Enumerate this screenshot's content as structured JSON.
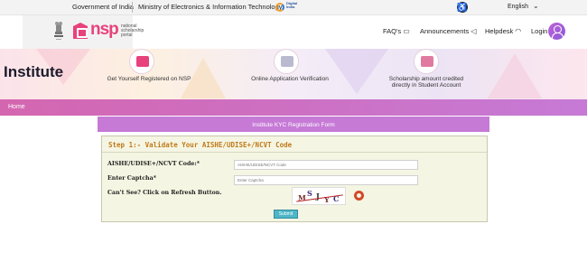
{
  "gov_bar": {
    "government": "Government of India",
    "ministry": "Ministry of Electronics & Information Technology",
    "digital_india": "Digital India",
    "language": "English"
  },
  "header": {
    "logo_text": "nsp",
    "logo_sub": "national scholarship portal",
    "nav": {
      "faqs": "FAQ's",
      "announcements": "Announcements",
      "helpdesk": "Helpdesk",
      "login": "Login"
    }
  },
  "banner": {
    "title": "Institute",
    "steps": [
      {
        "label": "Get Yourself Registered on NSP",
        "icon": "register-icon"
      },
      {
        "label": "Online Application Verification",
        "icon": "verification-icon"
      },
      {
        "label": "Scholarship amount credited directly in Student Account",
        "icon": "scholarship-icon"
      }
    ]
  },
  "breadcrumb": {
    "home": "Home"
  },
  "form": {
    "title": "Institute KYC Registration Form",
    "step_heading": "Step 1:- Validate Your AISHE/UDISE+/NCVT Code",
    "code_label": "AISHE/UDISE+/NCVT Code:*",
    "code_placeholder": "AISHE/UDISE/NCVT Code",
    "captcha_label": "Enter Captcha*",
    "captcha_placeholder": "Enter Captcha",
    "refresh_hint": "Can't See? Click on Refresh Button.",
    "captcha_chars": [
      "M",
      "S",
      "J",
      "Y",
      "C"
    ],
    "submit_label": "Submit"
  },
  "colors": {
    "brand_pink": "#e8427c",
    "bar_purple": "#c67ad6",
    "step_orange": "#c07a18",
    "submit_teal": "#4fb6c7"
  }
}
